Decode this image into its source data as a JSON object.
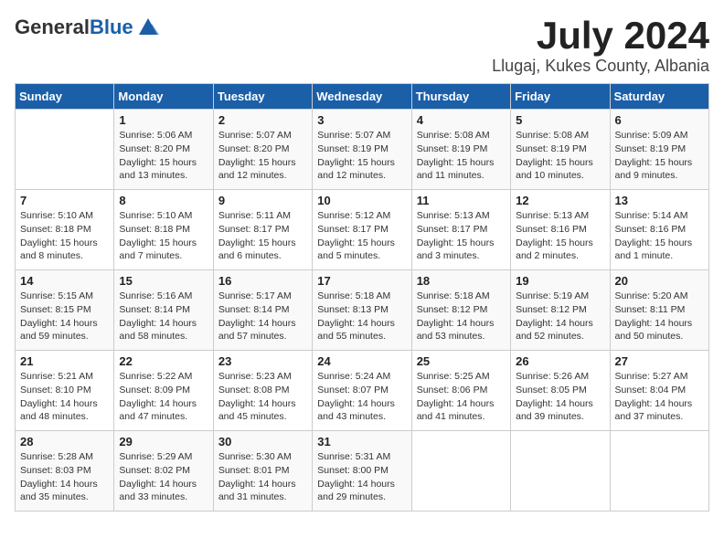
{
  "logo": {
    "general": "General",
    "blue": "Blue"
  },
  "title": "July 2024",
  "location": "Llugaj, Kukes County, Albania",
  "days_of_week": [
    "Sunday",
    "Monday",
    "Tuesday",
    "Wednesday",
    "Thursday",
    "Friday",
    "Saturday"
  ],
  "weeks": [
    [
      {
        "day": "",
        "info": ""
      },
      {
        "day": "1",
        "info": "Sunrise: 5:06 AM\nSunset: 8:20 PM\nDaylight: 15 hours\nand 13 minutes."
      },
      {
        "day": "2",
        "info": "Sunrise: 5:07 AM\nSunset: 8:20 PM\nDaylight: 15 hours\nand 12 minutes."
      },
      {
        "day": "3",
        "info": "Sunrise: 5:07 AM\nSunset: 8:19 PM\nDaylight: 15 hours\nand 12 minutes."
      },
      {
        "day": "4",
        "info": "Sunrise: 5:08 AM\nSunset: 8:19 PM\nDaylight: 15 hours\nand 11 minutes."
      },
      {
        "day": "5",
        "info": "Sunrise: 5:08 AM\nSunset: 8:19 PM\nDaylight: 15 hours\nand 10 minutes."
      },
      {
        "day": "6",
        "info": "Sunrise: 5:09 AM\nSunset: 8:19 PM\nDaylight: 15 hours\nand 9 minutes."
      }
    ],
    [
      {
        "day": "7",
        "info": "Sunrise: 5:10 AM\nSunset: 8:18 PM\nDaylight: 15 hours\nand 8 minutes."
      },
      {
        "day": "8",
        "info": "Sunrise: 5:10 AM\nSunset: 8:18 PM\nDaylight: 15 hours\nand 7 minutes."
      },
      {
        "day": "9",
        "info": "Sunrise: 5:11 AM\nSunset: 8:17 PM\nDaylight: 15 hours\nand 6 minutes."
      },
      {
        "day": "10",
        "info": "Sunrise: 5:12 AM\nSunset: 8:17 PM\nDaylight: 15 hours\nand 5 minutes."
      },
      {
        "day": "11",
        "info": "Sunrise: 5:13 AM\nSunset: 8:17 PM\nDaylight: 15 hours\nand 3 minutes."
      },
      {
        "day": "12",
        "info": "Sunrise: 5:13 AM\nSunset: 8:16 PM\nDaylight: 15 hours\nand 2 minutes."
      },
      {
        "day": "13",
        "info": "Sunrise: 5:14 AM\nSunset: 8:16 PM\nDaylight: 15 hours\nand 1 minute."
      }
    ],
    [
      {
        "day": "14",
        "info": "Sunrise: 5:15 AM\nSunset: 8:15 PM\nDaylight: 14 hours\nand 59 minutes."
      },
      {
        "day": "15",
        "info": "Sunrise: 5:16 AM\nSunset: 8:14 PM\nDaylight: 14 hours\nand 58 minutes."
      },
      {
        "day": "16",
        "info": "Sunrise: 5:17 AM\nSunset: 8:14 PM\nDaylight: 14 hours\nand 57 minutes."
      },
      {
        "day": "17",
        "info": "Sunrise: 5:18 AM\nSunset: 8:13 PM\nDaylight: 14 hours\nand 55 minutes."
      },
      {
        "day": "18",
        "info": "Sunrise: 5:18 AM\nSunset: 8:12 PM\nDaylight: 14 hours\nand 53 minutes."
      },
      {
        "day": "19",
        "info": "Sunrise: 5:19 AM\nSunset: 8:12 PM\nDaylight: 14 hours\nand 52 minutes."
      },
      {
        "day": "20",
        "info": "Sunrise: 5:20 AM\nSunset: 8:11 PM\nDaylight: 14 hours\nand 50 minutes."
      }
    ],
    [
      {
        "day": "21",
        "info": "Sunrise: 5:21 AM\nSunset: 8:10 PM\nDaylight: 14 hours\nand 48 minutes."
      },
      {
        "day": "22",
        "info": "Sunrise: 5:22 AM\nSunset: 8:09 PM\nDaylight: 14 hours\nand 47 minutes."
      },
      {
        "day": "23",
        "info": "Sunrise: 5:23 AM\nSunset: 8:08 PM\nDaylight: 14 hours\nand 45 minutes."
      },
      {
        "day": "24",
        "info": "Sunrise: 5:24 AM\nSunset: 8:07 PM\nDaylight: 14 hours\nand 43 minutes."
      },
      {
        "day": "25",
        "info": "Sunrise: 5:25 AM\nSunset: 8:06 PM\nDaylight: 14 hours\nand 41 minutes."
      },
      {
        "day": "26",
        "info": "Sunrise: 5:26 AM\nSunset: 8:05 PM\nDaylight: 14 hours\nand 39 minutes."
      },
      {
        "day": "27",
        "info": "Sunrise: 5:27 AM\nSunset: 8:04 PM\nDaylight: 14 hours\nand 37 minutes."
      }
    ],
    [
      {
        "day": "28",
        "info": "Sunrise: 5:28 AM\nSunset: 8:03 PM\nDaylight: 14 hours\nand 35 minutes."
      },
      {
        "day": "29",
        "info": "Sunrise: 5:29 AM\nSunset: 8:02 PM\nDaylight: 14 hours\nand 33 minutes."
      },
      {
        "day": "30",
        "info": "Sunrise: 5:30 AM\nSunset: 8:01 PM\nDaylight: 14 hours\nand 31 minutes."
      },
      {
        "day": "31",
        "info": "Sunrise: 5:31 AM\nSunset: 8:00 PM\nDaylight: 14 hours\nand 29 minutes."
      },
      {
        "day": "",
        "info": ""
      },
      {
        "day": "",
        "info": ""
      },
      {
        "day": "",
        "info": ""
      }
    ]
  ]
}
